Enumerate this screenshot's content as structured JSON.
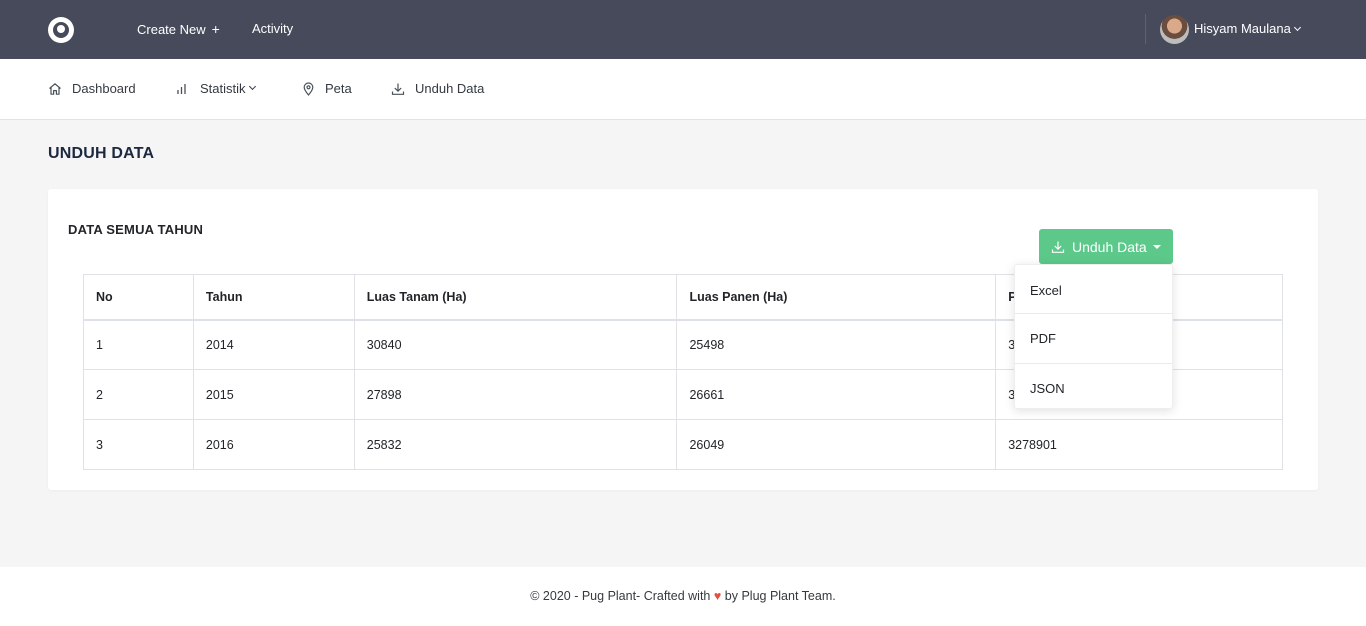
{
  "topbar": {
    "create_new": "Create New",
    "plus": "+",
    "activity": "Activity",
    "user_name": "Hisyam Maulana"
  },
  "nav": {
    "dashboard": "Dashboard",
    "statistik": "Statistik",
    "peta": "Peta",
    "unduh": "Unduh Data"
  },
  "page": {
    "title": "UNDUH DATA"
  },
  "card": {
    "title": "DATA SEMUA TAHUN",
    "download_button": "Unduh Data"
  },
  "table": {
    "headers": [
      "No",
      "Tahun",
      "Luas Tanam (Ha)",
      "Luas Panen (Ha)",
      "P"
    ],
    "rows": [
      [
        "1",
        "2014",
        "30840",
        "25498",
        "3"
      ],
      [
        "2",
        "2015",
        "27898",
        "26661",
        "3"
      ],
      [
        "3",
        "2016",
        "25832",
        "26049",
        "3278901"
      ]
    ]
  },
  "dropdown": {
    "items": [
      "Excel",
      "PDF",
      "JSON"
    ]
  },
  "footer": {
    "before": "© 2020 - Pug Plant- Crafted with",
    "heart": "♥",
    "after": "by Plug Plant Team."
  },
  "colors": {
    "topbar": "#464a5a",
    "accent_green": "#5cc98a",
    "heart": "#e74c3c"
  }
}
